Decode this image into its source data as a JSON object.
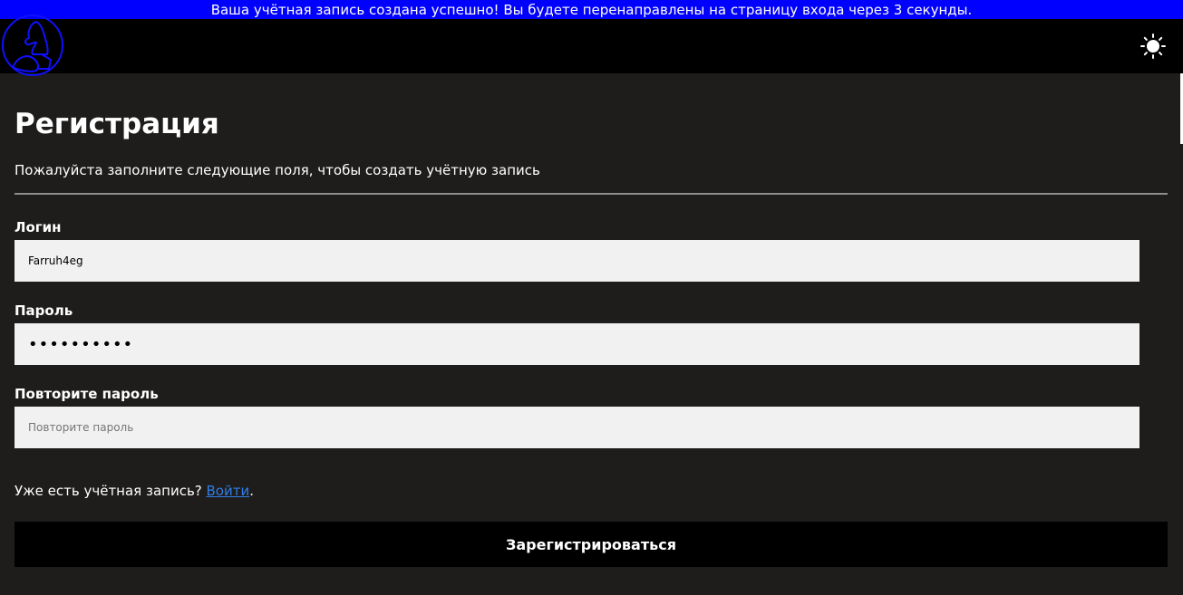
{
  "banner": {
    "message": "Ваша учётная запись создана успешно! Вы будете перенаправлены на страницу входа через 3 секунды."
  },
  "header": {
    "logo_icon": "knight-logo-icon",
    "theme_toggle_icon": "sun-icon"
  },
  "form": {
    "title": "Регистрация",
    "subtitle": "Пожалуйста заполните следующие поля, чтобы создать учётную запись",
    "fields": [
      {
        "label": "Логин",
        "value": "Farruh4eg",
        "placeholder": ""
      },
      {
        "label": "Пароль",
        "value": "••••••••••",
        "placeholder": ""
      },
      {
        "label": "Повторите пароль",
        "value": "",
        "placeholder": "Повторите пароль"
      }
    ],
    "login_prompt": {
      "text": "Уже есть учётная запись? ",
      "link_text": "Войти",
      "suffix": "."
    },
    "submit_label": "Зарегистрироваться"
  },
  "colors": {
    "banner_bg": "#0000ff",
    "header_bg": "#000000",
    "page_bg": "#1e1d1b",
    "input_bg": "#f1f1f1",
    "link": "#2f7fe8",
    "button_bg": "#000000"
  }
}
